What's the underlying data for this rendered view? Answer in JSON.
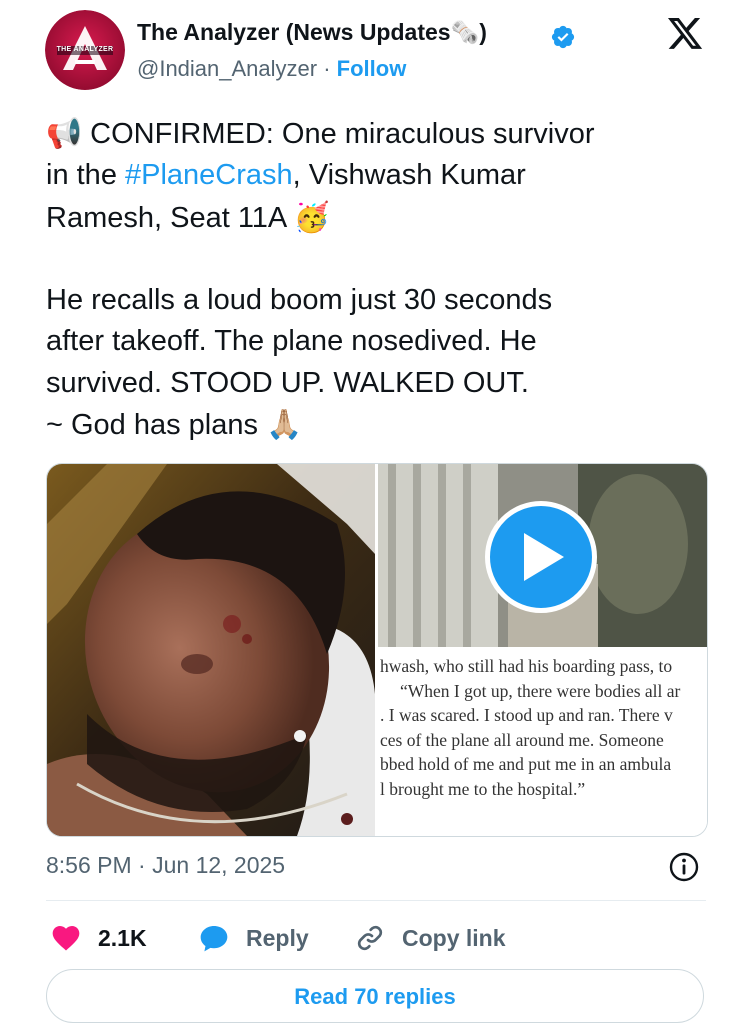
{
  "author": {
    "display_name": "The Analyzer (News Updates",
    "name_emoji": "🗞️",
    "name_suffix": ")",
    "handle": "@Indian_Analyzer",
    "separator": " · ",
    "follow_label": "Follow",
    "avatar_text": "THE ANALYZER",
    "avatar_icon": "triangle-a-logo",
    "verified_icon": "verified-badge-icon"
  },
  "platform_icon": "x-logo-icon",
  "tweet": {
    "line1_emoji": "📢",
    "line1_text": " CONFIRMED: One miraculous survivor",
    "line2_prefix": "in the ",
    "hashtag": "#PlaneCrash",
    "line2_suffix": ", Vishwash Kumar",
    "line3_text": "Ramesh, Seat 11A ",
    "line3_emoji": "🥳",
    "paragraph2": "He recalls a loud boom just 30 seconds\nafter takeoff. The plane nosedived. He\nsurvived. STOOD UP. WALKED OUT.\n~ God has plans ",
    "paragraph2_emoji": "🙏🏼"
  },
  "media": {
    "play_icon": "play-icon",
    "article_lines": [
      "hwash, who still had his boarding pass, to",
      "“When I got up, there were bodies all ar",
      ". I was scared. I stood up and ran. There v",
      "ces of the plane all around me. Someone",
      "bbed hold of me and put me in an ambula",
      "l brought me to the hospital.”"
    ]
  },
  "meta": {
    "timestamp": "8:56 PM · Jun 12, 2025",
    "info_icon": "info-icon"
  },
  "actions": {
    "likes_count": "2.1K",
    "like_icon": "heart-icon",
    "like_color": "#f91880",
    "reply_label": "Reply",
    "reply_icon": "speech-bubble-icon",
    "reply_color": "#1d9bf0",
    "copy_label": "Copy link",
    "copy_icon": "link-icon"
  },
  "read_replies_label": "Read 70 replies",
  "colors": {
    "accent": "#1d9bf0",
    "muted_text": "#536471",
    "border": "#cfd9de"
  }
}
